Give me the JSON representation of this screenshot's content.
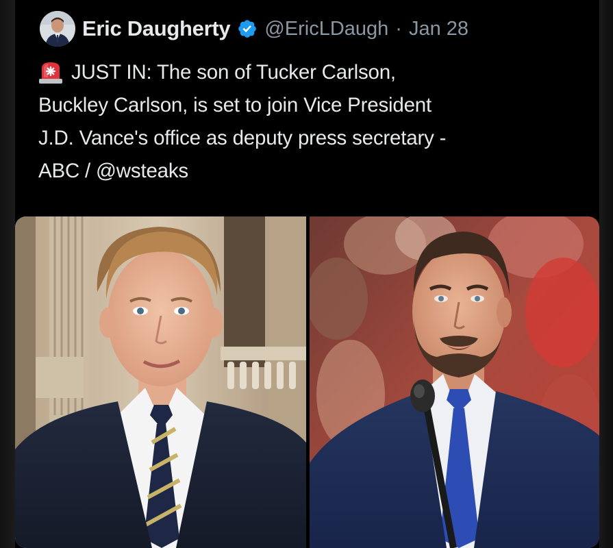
{
  "tweet": {
    "author": {
      "display_name": "Eric Daugherty",
      "handle": "@EricLDaugh",
      "verified": true,
      "verified_color": "#1d9bf0"
    },
    "separator": "·",
    "date": "Jan 28",
    "lines": [
      {
        "emoji": "rotating-light-icon",
        "text": "JUST IN: The son of Tucker Carlson,"
      },
      {
        "text": "Buckley Carlson, is set to join Vice President"
      },
      {
        "text": "J.D. Vance's office as deputy press secretary -"
      },
      {
        "text": "ABC / @wsteaks"
      }
    ],
    "media": [
      {
        "name": "photo-buckley-carlson"
      },
      {
        "name": "photo-jd-vance"
      }
    ]
  },
  "colors": {
    "background": "#000000",
    "text": "#e7e9ea",
    "muted": "#8b98a5"
  }
}
